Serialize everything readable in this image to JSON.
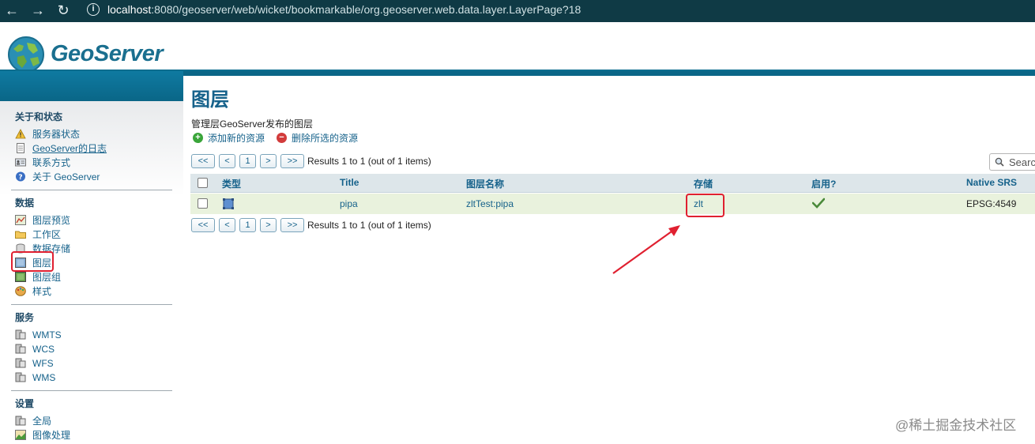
{
  "browser": {
    "url_host": "localhost",
    "url_rest": ":8080/geoserver/web/wicket/bookmarkable/org.geoserver.web.data.layer.LayerPage?18",
    "back_glyph": "←",
    "forward_glyph": "→",
    "reload_glyph": "↻",
    "info_glyph": "i"
  },
  "header": {
    "logo_text": "GeoServer"
  },
  "sidebar": {
    "sections": [
      {
        "title": "关于和状态",
        "items": [
          {
            "label": "服务器状态",
            "icon": "warning-icon"
          },
          {
            "label": "GeoServer的日志",
            "icon": "document-icon"
          },
          {
            "label": "联系方式",
            "icon": "contact-card-icon"
          },
          {
            "label": "关于 GeoServer",
            "icon": "help-icon"
          }
        ]
      },
      {
        "title": "数据",
        "items": [
          {
            "label": "图层预览",
            "icon": "layer-preview-icon"
          },
          {
            "label": "工作区",
            "icon": "folder-icon"
          },
          {
            "label": "数据存储",
            "icon": "database-icon"
          },
          {
            "label": "图层",
            "icon": "layer-icon"
          },
          {
            "label": "图层组",
            "icon": "layer-group-icon"
          },
          {
            "label": "样式",
            "icon": "palette-icon"
          }
        ]
      },
      {
        "title": "服务",
        "items": [
          {
            "label": "WMTS",
            "icon": "server-icon"
          },
          {
            "label": "WCS",
            "icon": "server-icon"
          },
          {
            "label": "WFS",
            "icon": "server-icon"
          },
          {
            "label": "WMS",
            "icon": "server-icon"
          }
        ]
      },
      {
        "title": "设置",
        "items": [
          {
            "label": "全局",
            "icon": "server-icon"
          },
          {
            "label": "图像处理",
            "icon": "image-processing-icon"
          }
        ]
      }
    ]
  },
  "main": {
    "title": "图层",
    "description": "管理层GeoServer发布的图层",
    "actions": {
      "add_label": "添加新的资源",
      "remove_label": "删除所选的资源"
    },
    "pager": {
      "first": "<<",
      "prev": "<",
      "page": "1",
      "next": ">",
      "last": ">>",
      "results": "Results 1 to 1 (out of 1 items)"
    },
    "search": {
      "placeholder": "Search"
    },
    "table": {
      "headers": [
        "类型",
        "Title",
        "图层名称",
        "存储",
        "启用?",
        "Native SRS"
      ],
      "rows": [
        {
          "type_icon": "vector-layer-icon",
          "title": "pipa",
          "name": "zltTest:pipa",
          "store": "zlt",
          "enabled_icon": "checkmark-icon",
          "srs": "EPSG:4549"
        }
      ]
    }
  },
  "annotations": {
    "highlight_color": "#e02030"
  },
  "watermark": "@稀土掘金技术社区"
}
